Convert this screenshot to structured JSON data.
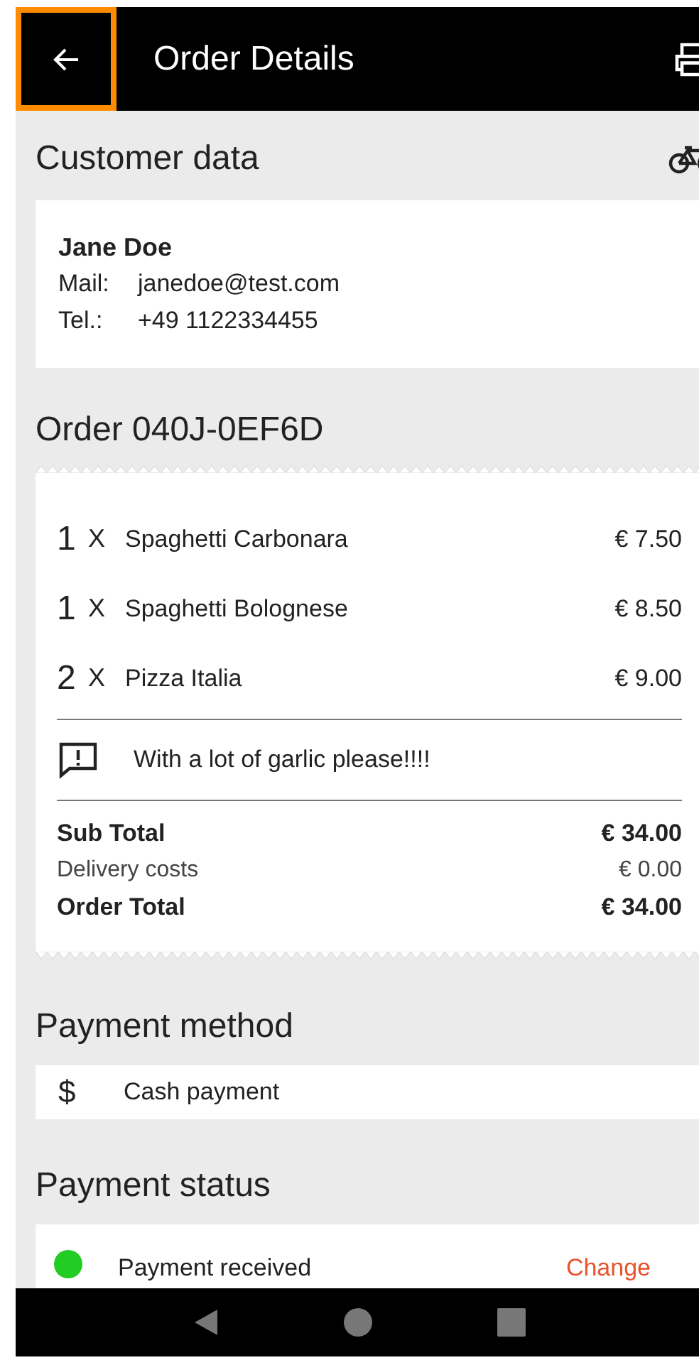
{
  "app_bar": {
    "title": "Order Details"
  },
  "customer": {
    "heading": "Customer data",
    "name": "Jane Doe",
    "mail_label": "Mail:",
    "mail": "janedoe@test.com",
    "tel_label": "Tel.:",
    "tel": "+49 1122334455"
  },
  "order": {
    "heading": "Order 040J-0EF6D",
    "items": [
      {
        "qty": "1",
        "x": "X",
        "name": "Spaghetti Carbonara",
        "price": "€ 7.50"
      },
      {
        "qty": "1",
        "x": "X",
        "name": "Spaghetti Bolognese",
        "price": "€ 8.50"
      },
      {
        "qty": "2",
        "x": "X",
        "name": "Pizza Italia",
        "price": "€ 9.00"
      }
    ],
    "note": "With a lot of garlic please!!!!",
    "totals": [
      {
        "label": "Sub Total",
        "value": "€ 34.00",
        "bold": true
      },
      {
        "label": "Delivery costs",
        "value": "€ 0.00",
        "bold": false
      },
      {
        "label": "Order Total",
        "value": "€ 34.00",
        "bold": true
      }
    ]
  },
  "payment_method": {
    "heading": "Payment method",
    "symbol": "$",
    "label": "Cash payment"
  },
  "payment_status": {
    "heading": "Payment status",
    "status": "Payment received",
    "color": "#22cc22",
    "action": "Change"
  }
}
